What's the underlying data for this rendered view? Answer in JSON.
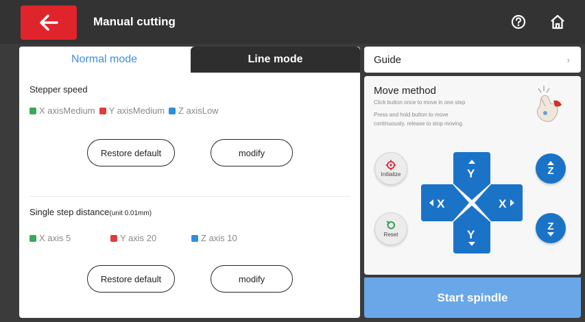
{
  "header": {
    "title": "Manual cutting",
    "icons": {
      "back": "arrow-left-icon",
      "help": "question-circle-icon",
      "home": "home-icon"
    },
    "back_color": "#e0242c"
  },
  "tabs": [
    {
      "label": "Normal mode",
      "active": true
    },
    {
      "label": "Line mode",
      "active": false
    }
  ],
  "stepper_speed": {
    "title": "Stepper speed",
    "axes": [
      {
        "label": "X axisMedium",
        "color": "#3aa957"
      },
      {
        "label": "Y axisMedium",
        "color": "#e33a3a"
      },
      {
        "label": "Z axisLow",
        "color": "#2a8fdf"
      }
    ],
    "restore_label": "Restore default",
    "modify_label": "modify"
  },
  "single_step": {
    "title": "Single step distance",
    "unit": "(unit 0.01mm)",
    "axes": [
      {
        "label": "X axis 5",
        "color": "#3aa957"
      },
      {
        "label": "Y axis 20",
        "color": "#e33a3a"
      },
      {
        "label": "Z axis 10",
        "color": "#2a8fdf"
      }
    ],
    "restore_label": "Restore default",
    "modify_label": "modify"
  },
  "guide": {
    "label": "Guide",
    "chevron": "›"
  },
  "move_method": {
    "title": "Move method",
    "desc1": "Click button once to move in one step",
    "desc2": "Press and hold button to move",
    "desc3": "continuously, release to stop moving.",
    "initialize_label": "Initialize",
    "reset_label": "Reset",
    "y_label": "Y",
    "x_left_label": "X",
    "x_right_label": "X",
    "z_label": "Z"
  },
  "spindle": {
    "label": "Start spindle"
  },
  "colors": {
    "accent_blue": "#1b73c8",
    "tab_active_text": "#3a8ee6",
    "spindle": "#69a7e8"
  }
}
